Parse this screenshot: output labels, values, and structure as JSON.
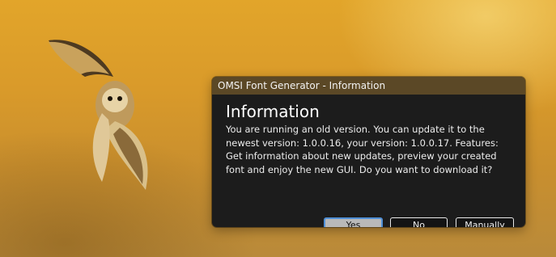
{
  "window": {
    "title": "OMSI Font Generator - Information"
  },
  "dialog": {
    "heading": "Information",
    "message": "You are running an old version. You can update it to the newest version: 1.0.0.16, your version: 1.0.0.17. Features: Get information about new updates, preview your created font and enjoy the new GUI. Do you want to download it?"
  },
  "buttons": {
    "yes": "Yes",
    "no": "No",
    "manually": "Manually"
  },
  "colors": {
    "titlebar": "#5b4826",
    "dialog_background": "#1c1c1c",
    "default_button_focus": "#4f8fd6",
    "wallpaper": "#d99a2a"
  },
  "icons": {
    "wallpaper_image": "owl-in-flight"
  }
}
